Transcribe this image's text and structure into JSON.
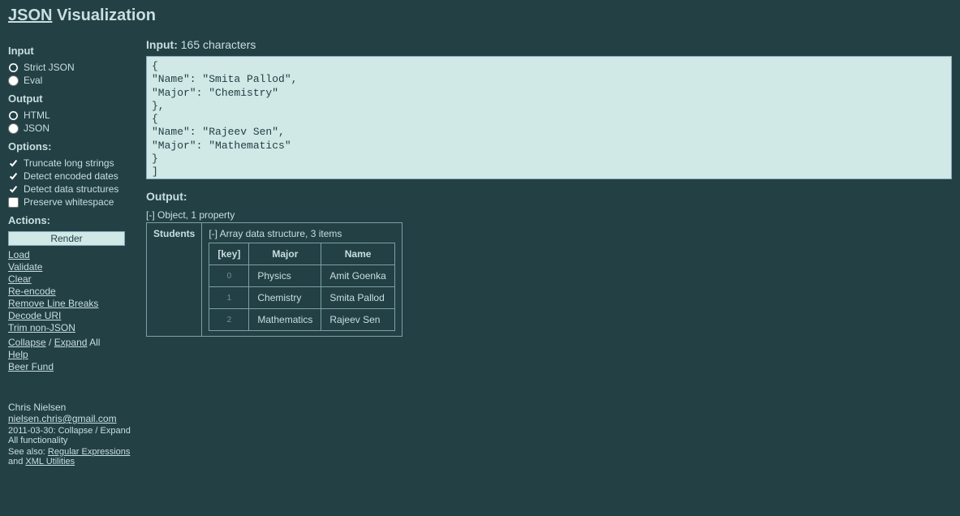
{
  "page_title_link": "JSON",
  "page_title_rest": " Visualization",
  "sidebar": {
    "input_heading": "Input",
    "input_radios": [
      {
        "label": "Strict JSON",
        "checked": true
      },
      {
        "label": "Eval",
        "checked": false
      }
    ],
    "output_heading": "Output",
    "output_radios": [
      {
        "label": "HTML",
        "checked": true
      },
      {
        "label": "JSON",
        "checked": false
      }
    ],
    "options_heading": "Options:",
    "options": [
      {
        "label": "Truncate long strings",
        "checked": true
      },
      {
        "label": "Detect encoded dates",
        "checked": true
      },
      {
        "label": "Detect data structures",
        "checked": true
      },
      {
        "label": "Preserve whitespace",
        "checked": false
      }
    ],
    "actions_heading": "Actions:",
    "render_button": "Render",
    "actions": [
      "Load",
      "Validate",
      "Clear",
      "Re-encode",
      "Remove Line Breaks",
      "Decode URI",
      "Trim non-JSON"
    ],
    "collapse": "Collapse",
    "expand": "Expand",
    "expand_suffix": " All",
    "help": "Help",
    "beer": "Beer Fund"
  },
  "main": {
    "input_label": "Input:",
    "input_count": "165 characters",
    "textarea_value": "{\n\"Name\": \"Smita Pallod\",\n\"Major\": \"Chemistry\"\n},\n{\n\"Name\": \"Rajeev Sen\",\n\"Major\": \"Mathematics\"\n}\n]\n}",
    "output_label": "Output:",
    "tree_root": "[-] Object, 1 property",
    "prop_name": "Students",
    "array_label": "[-] Array data structure, 3 items",
    "columns": [
      "[key]",
      "Major",
      "Name"
    ],
    "rows": [
      {
        "key": "0",
        "Major": "Physics",
        "Name": "Amit Goenka"
      },
      {
        "key": "1",
        "Major": "Chemistry",
        "Name": "Smita Pallod"
      },
      {
        "key": "2",
        "Major": "Mathematics",
        "Name": "Rajeev Sen"
      }
    ]
  },
  "footer": {
    "author": "Chris Nielsen",
    "email": "nielsen.chris@gmail.com",
    "changelog": "2011-03-30: Collapse / Expand All functionality",
    "see_also_prefix": "See also: ",
    "link1": "Regular Expressions",
    "and": " and ",
    "link2": "XML Utilities"
  }
}
